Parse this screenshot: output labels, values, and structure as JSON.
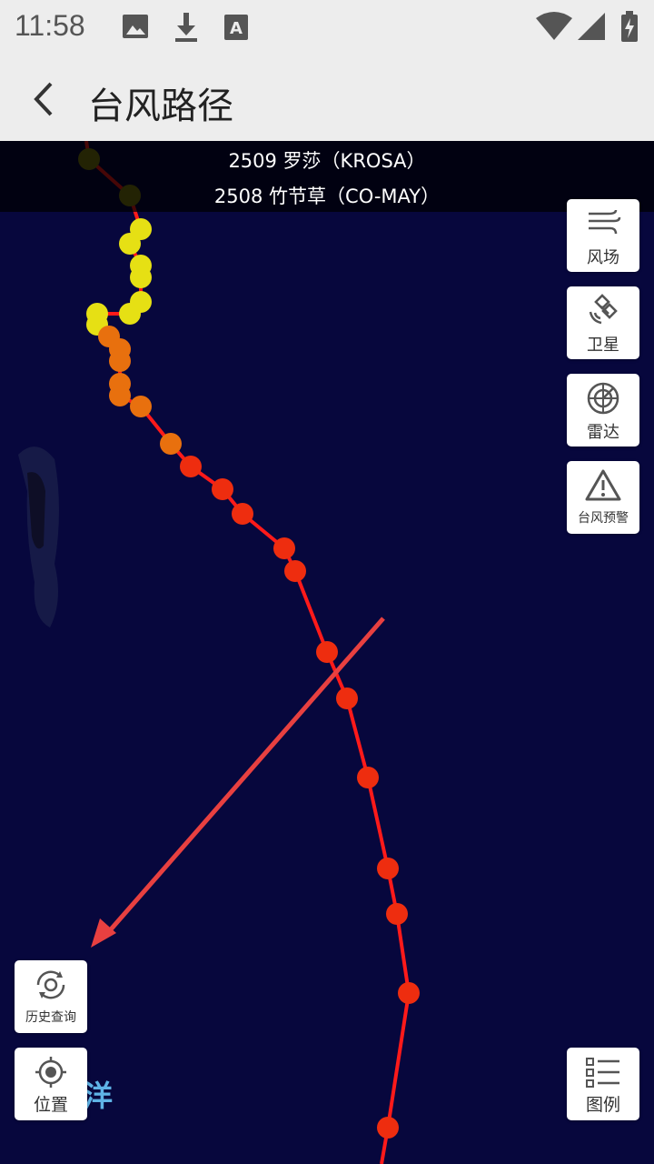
{
  "status_bar": {
    "time": "11:58",
    "icons": [
      "image-icon",
      "download-icon",
      "a-icon",
      "wifi-icon",
      "signal-icon",
      "battery-icon"
    ]
  },
  "app_bar": {
    "title": "台风路径"
  },
  "typhoons": [
    {
      "label": "2509 罗莎（KROSA）"
    },
    {
      "label": "2508 竹节草（CO-MAY）"
    }
  ],
  "side_tools": [
    {
      "label": "风场",
      "icon": "wind-icon"
    },
    {
      "label": "卫星",
      "icon": "satellite-icon"
    },
    {
      "label": "雷达",
      "icon": "radar-icon"
    },
    {
      "label": "台风预警",
      "icon": "warning-icon"
    }
  ],
  "history_button": {
    "label": "历史查询",
    "icon": "history-icon"
  },
  "location_button": {
    "label": "位置",
    "icon": "locate-icon"
  },
  "legend_button": {
    "label": "图例",
    "icon": "list-icon"
  },
  "map_label": "洋",
  "colors": {
    "map_bg": "#07073d",
    "track_line": "#ff1a1a",
    "point_olive": "#7d7d10",
    "point_yellow": "#e6e014",
    "point_orange": "#e8700e",
    "point_red": "#ee2d0f",
    "arrow": "#e84040"
  }
}
